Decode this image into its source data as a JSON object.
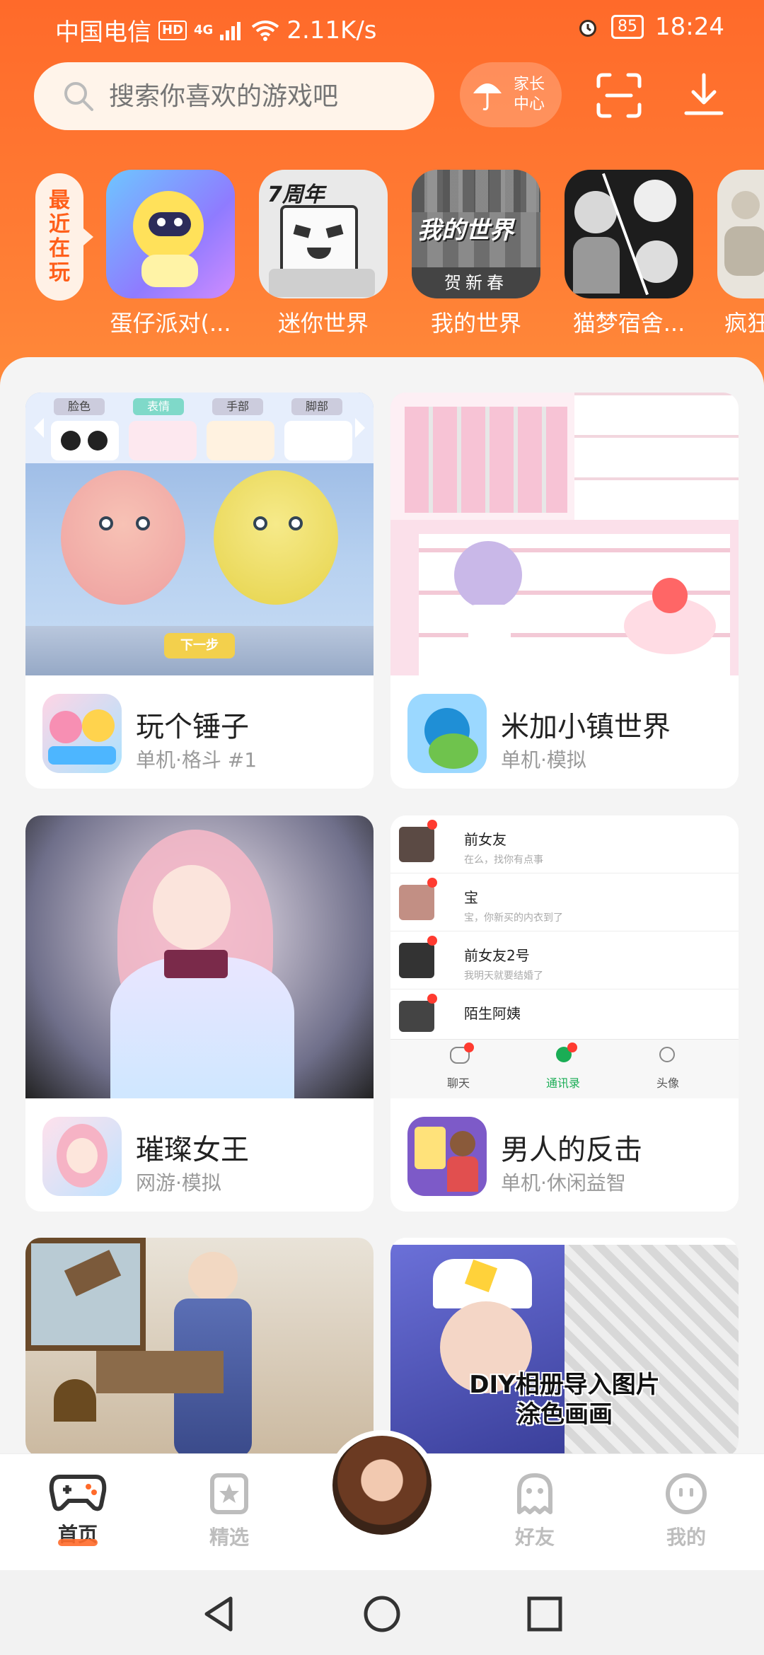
{
  "status": {
    "carrier": "中国电信",
    "hd": "HD",
    "network": "4G",
    "speed": "2.11K/s",
    "battery": "85",
    "time": "18:24"
  },
  "header": {
    "search_placeholder": "搜索你喜欢的游戏吧",
    "parent_center_label": "家长中心"
  },
  "recent": {
    "tag": [
      "最",
      "近",
      "在",
      "玩"
    ],
    "items": [
      {
        "name": "蛋仔派对(..."
      },
      {
        "name": "迷你世界"
      },
      {
        "name": "我的世界"
      },
      {
        "name": "猫梦宿舍..."
      },
      {
        "name": "疯狂"
      }
    ]
  },
  "cards": [
    {
      "title": "玩个锤子",
      "tags": "单机·格斗 #1"
    },
    {
      "title": "米加小镇世界",
      "tags": "单机·模拟"
    },
    {
      "title": "璀璨女王",
      "tags": "网游·模拟"
    },
    {
      "title": "男人的反击",
      "tags": "单机·休闲益智"
    },
    {
      "banner_text_line1": "DIY相册导入图片",
      "banner_text_line2": "涂色画画"
    }
  ],
  "card2_banner": {
    "contacts": [
      {
        "name": "前女友",
        "msg": "在么，找你有点事"
      },
      {
        "name": "宝",
        "msg": "宝，你新买的内衣到了"
      },
      {
        "name": "前女友2号",
        "msg": "我明天就要结婚了"
      },
      {
        "name": "陌生阿姨",
        "msg": ""
      }
    ],
    "tabs": [
      "聊天",
      "通讯录",
      "头像"
    ]
  },
  "card0_banner": {
    "tabs": [
      "脸色",
      "表情",
      "手部",
      "脚部"
    ],
    "next": "下一步"
  },
  "bottom_nav": {
    "items": [
      "首页",
      "精选",
      "好友",
      "我的"
    ]
  },
  "colors": {
    "accent": "#ff6a2a"
  }
}
